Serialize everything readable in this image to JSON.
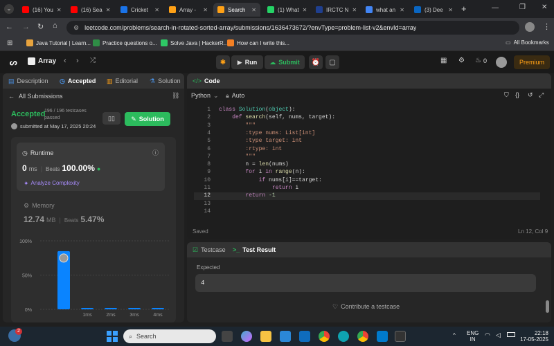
{
  "browser": {
    "tabs": [
      {
        "label": "(16) You",
        "color": "#ff0000"
      },
      {
        "label": "(16) Sea",
        "color": "#ff0000"
      },
      {
        "label": "Cricket",
        "color": "#1a73e8"
      },
      {
        "label": "Array -",
        "color": "#ffa116"
      },
      {
        "label": "Search",
        "color": "#ffa116",
        "active": true
      },
      {
        "label": "(1) What",
        "color": "#25d366"
      },
      {
        "label": "IRCTC N",
        "color": "#1f3f8f"
      },
      {
        "label": "what an",
        "color": "#4285f4"
      },
      {
        "label": "(3) Dee",
        "color": "#0a66c2"
      }
    ],
    "url": "leetcode.com/problems/search-in-rotated-sorted-array/submissions/1636473672/?envType=problem-list-v2&envId=array",
    "bookmarks": [
      {
        "label": "Java Tutorial | Learn...",
        "color": "#e7a33e"
      },
      {
        "label": "Practice questions o...",
        "color": "#2f8d46"
      },
      {
        "label": "Solve Java | HackerR...",
        "color": "#2ec866"
      },
      {
        "label": "How can I write this...",
        "color": "#f48024"
      }
    ],
    "all_bookmarks": "All Bookmarks"
  },
  "header": {
    "problem_list": "Array",
    "run": "Run",
    "submit": "Submit",
    "fire_count": "0",
    "premium": "Premium"
  },
  "left_panel": {
    "tabs": [
      "Description",
      "Accepted",
      "Editorial",
      "Solution"
    ],
    "all_submissions": "All Submissions",
    "status": "Accepted",
    "testcases": "196 / 196 testcases passed",
    "submitted": "submitted at May 17, 2025 20:24",
    "solution_button": "Solution",
    "runtime": {
      "title": "Runtime",
      "value": "0",
      "unit": "ms",
      "beats_label": "Beats",
      "beats": "100.00%",
      "analyze": "Analyze Complexity"
    },
    "memory": {
      "title": "Memory",
      "value": "12.74",
      "unit": "MB",
      "beats_label": "Beats",
      "beats": "5.47%"
    }
  },
  "chart_data": {
    "type": "bar",
    "categories": [
      "",
      "1ms",
      "2ms",
      "3ms",
      "4ms"
    ],
    "values": [
      85,
      2,
      2,
      2,
      2
    ],
    "ylim": [
      0,
      100
    ],
    "yticks": [
      "100%",
      "50%",
      "0%"
    ],
    "bar_color": "#0a84ff"
  },
  "editor": {
    "title": "Code",
    "language": "Python",
    "auto": "Auto",
    "lines": [
      "class Solution(object):",
      "    def search(self, nums, target):",
      "        \"\"\"",
      "        :type nums: List[int]",
      "        :type target: int",
      "        :rtype: int",
      "        \"\"\"",
      "        n = len(nums)",
      "        for i in range(n):",
      "            if nums[i]==target:",
      "                return i",
      "        return -1",
      "",
      ""
    ],
    "active_line": 12,
    "saved": "Saved",
    "cursor": "Ln 12, Col 9"
  },
  "result_panel": {
    "testcase_tab": "Testcase",
    "result_tab": "Test Result",
    "expected_label": "Expected",
    "expected_value": "4",
    "contribute": "Contribute a testcase"
  },
  "taskbar": {
    "search_placeholder": "Search",
    "lang": "ENG",
    "region": "IN",
    "time": "22:18",
    "date": "17-05-2025",
    "notif": "2"
  }
}
